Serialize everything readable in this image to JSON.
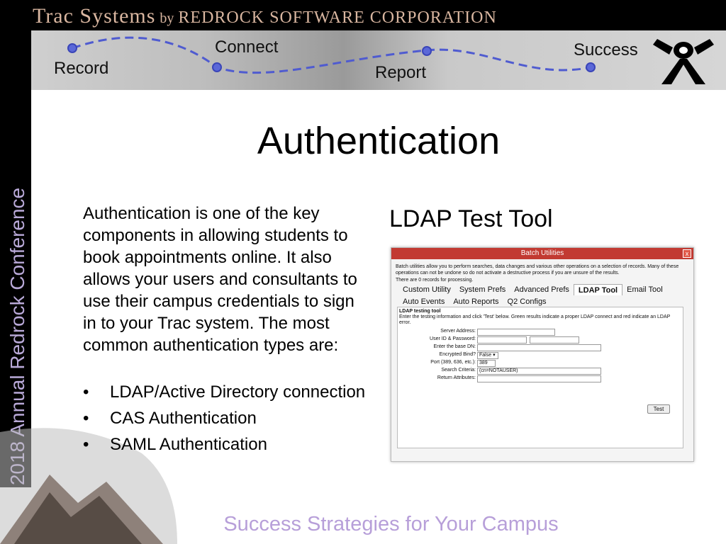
{
  "brand": {
    "part1": "Trac Systems",
    "part2": "by",
    "part3": "REDROCK SOFTWARE CORPORATION"
  },
  "banner": {
    "record": "Record",
    "connect": "Connect",
    "report": "Report",
    "success": "Success"
  },
  "sidebar": {
    "text": "2018 Annual Redrock Conference"
  },
  "slide": {
    "title": "Authentication",
    "body": "Authentication is one of the key components in allowing students to book appointments online. It also allows your users and consultants to use their campus credentials to sign in to your Trac system. The most common authentication types are:",
    "bullets": [
      "LDAP/Active Directory connection",
      "CAS Authentication",
      "SAML Authentication"
    ],
    "subhead": "LDAP Test Tool",
    "footer": "Success Strategies for Your Campus"
  },
  "dialog": {
    "title": "Batch Utilities",
    "close": "x",
    "description": "Batch utilities allow you to perform searches, data changes and various other operations on a selection of records. Many of these operations can not be undone so do not activate a destructive process if you are unsure of the results.",
    "count": "There are 0 records for processing.",
    "tabs_row1": [
      "Custom Utility",
      "System Prefs",
      "Advanced Prefs",
      "LDAP Tool",
      "Email Tool"
    ],
    "tabs_row2": [
      "Auto Events",
      "Auto Reports",
      "Q2 Configs"
    ],
    "panel_title": "LDAP testing tool",
    "panel_desc": "Enter the testing information and click 'Test' below. Green results indicate a proper LDAP connect and red indicate an LDAP error.",
    "fields": {
      "server": "Server Address:",
      "userid": "User ID & Password:",
      "basedn": "Enter the base DN:",
      "encrypted": "Encrypted Bind?",
      "encrypted_value": "False",
      "port": "Port (389, 636, etc.):",
      "port_value": "389",
      "search": "Search Criteria:",
      "search_value": "(cn=NOTAUSER)",
      "return": "Return Attributes:"
    },
    "test_button": "Test"
  },
  "colors": {
    "accent_purple": "#b79fd9",
    "route_dot": "#5b68d8",
    "dialog_title": "#c23a32"
  }
}
